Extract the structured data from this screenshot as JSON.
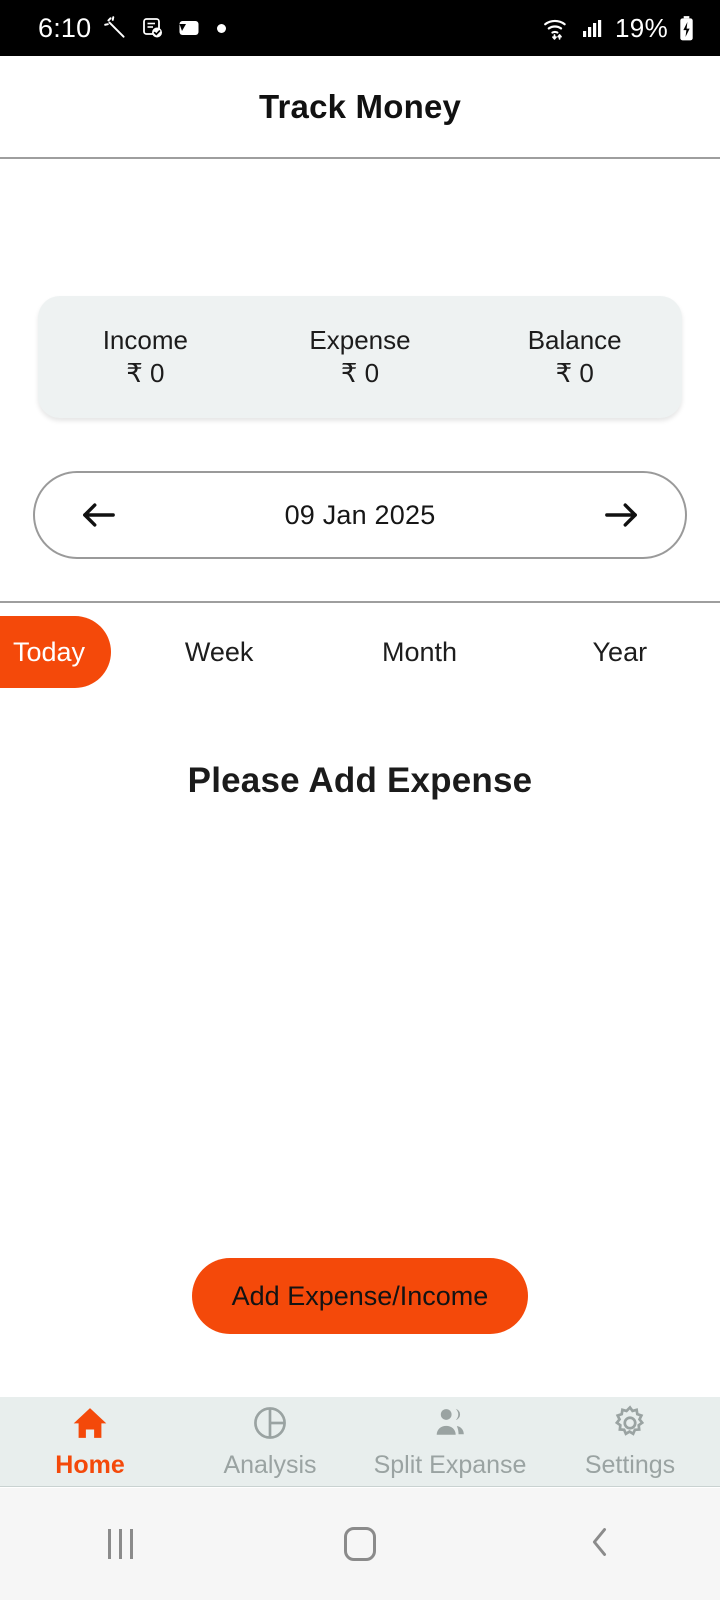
{
  "status_bar": {
    "time": "6:10",
    "left_icons": [
      "magic-wand-icon",
      "note-check-icon",
      "wallet-icon",
      "dot-icon"
    ],
    "wifi_icon": "wifi-arrows-icon",
    "signal_icon": "cellular-signal-icon",
    "battery_percent": "19%",
    "battery_icon": "battery-charging-icon"
  },
  "app_bar": {
    "title": "Track Money"
  },
  "summary": {
    "columns": [
      {
        "label": "Income",
        "value": "₹ 0"
      },
      {
        "label": "Expense",
        "value": "₹ 0"
      },
      {
        "label": "Balance",
        "value": "₹ 0"
      }
    ]
  },
  "date_selector": {
    "prev_icon": "arrow-left-icon",
    "date": "09 Jan 2025",
    "next_icon": "arrow-right-icon"
  },
  "period_tabs": {
    "items": [
      {
        "label": "Today",
        "active": true
      },
      {
        "label": "Week",
        "active": false
      },
      {
        "label": "Month",
        "active": false
      },
      {
        "label": "Year",
        "active": false
      }
    ]
  },
  "content": {
    "empty_message": "Please Add Expense"
  },
  "actions": {
    "add_button_label": "Add Expense/Income"
  },
  "bottom_nav": {
    "items": [
      {
        "label": "Home",
        "icon": "home-icon",
        "active": true
      },
      {
        "label": "Analysis",
        "icon": "pie-chart-icon",
        "active": false
      },
      {
        "label": "Split Expanse",
        "icon": "people-icon",
        "active": false
      },
      {
        "label": "Settings",
        "icon": "gear-icon",
        "active": false
      }
    ]
  },
  "android_nav": {
    "recents_icon": "recents-icon",
    "home_icon": "home-square-icon",
    "back_icon": "back-chevron-icon"
  },
  "colors": {
    "accent": "#f4490a",
    "card_bg": "#eef2f2",
    "nav_bg": "#e8eeed",
    "muted_text": "#9aa3a2"
  }
}
